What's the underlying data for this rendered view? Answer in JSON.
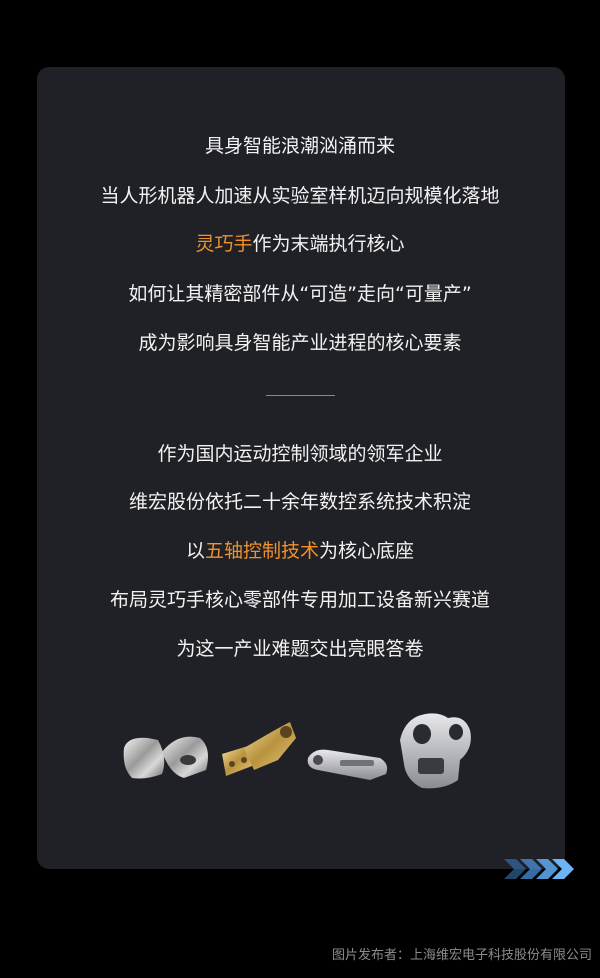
{
  "section1": {
    "line1": "具身智能浪潮汹涌而来",
    "line2": "当人形机器人加速从实验室样机迈向规模化落地",
    "line3_highlight": "灵巧手",
    "line3_rest": "作为末端执行核心",
    "line4": "如何让其精密部件从“可造”走向“可量产”",
    "line5": "成为影响具身智能产业进程的核心要素"
  },
  "section2": {
    "line1": "作为国内运动控制领域的领军企业",
    "line2": "维宏股份依托二十余年数控系统技术积淀",
    "line3_pre": "以",
    "line3_highlight": "五轴控制技术",
    "line3_post": "为核心底座",
    "line4": "布局灵巧手核心零部件专用加工设备新兴赛道",
    "line5": "为这一产业难题交出亮眼答卷"
  },
  "credit": "图片发布者：上海维宏电子科技股份有限公司",
  "colors": {
    "background": "#000000",
    "card": "#202126",
    "text": "#f2f2f2",
    "highlight": "#f0912a",
    "chevron": "#4a90d9",
    "credit": "#8c8c8c"
  },
  "icons": [
    "chevron-right-icon"
  ]
}
